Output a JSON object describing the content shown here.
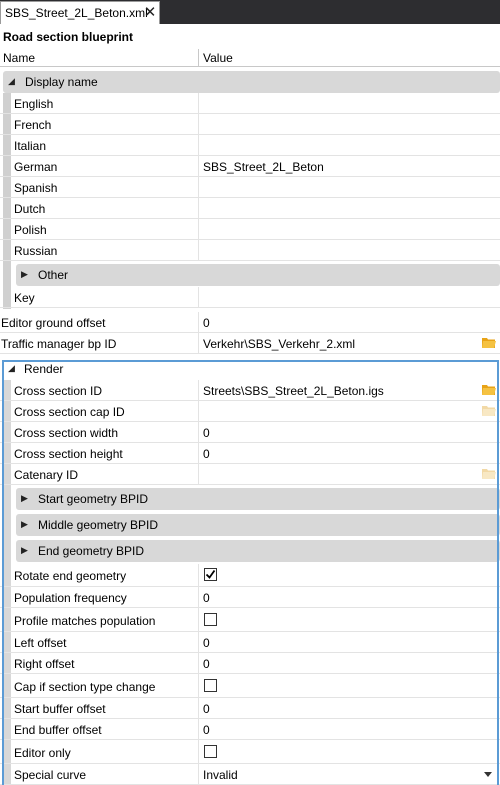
{
  "tab": {
    "title": "SBS_Street_2L_Beton.xml",
    "close": "✕"
  },
  "title": "Road section blueprint",
  "columns": {
    "name": "Name",
    "value": "Value"
  },
  "display_group": {
    "label": "Display name",
    "rows": [
      {
        "name": "English",
        "value": ""
      },
      {
        "name": "French",
        "value": ""
      },
      {
        "name": "Italian",
        "value": ""
      },
      {
        "name": "German",
        "value": "SBS_Street_2L_Beton"
      },
      {
        "name": "Spanish",
        "value": ""
      },
      {
        "name": "Dutch",
        "value": ""
      },
      {
        "name": "Polish",
        "value": ""
      },
      {
        "name": "Russian",
        "value": ""
      }
    ],
    "other_label": "Other",
    "key_label": "Key"
  },
  "editor_ground_offset": {
    "name": "Editor ground offset",
    "value": "0"
  },
  "traffic_manager": {
    "name": "Traffic manager bp ID",
    "value": "Verkehr\\SBS_Verkehr_2.xml",
    "icon": "folder-icon"
  },
  "render": {
    "label": "Render",
    "cross_section_id": {
      "name": "Cross section ID",
      "value": "Streets\\SBS_Street_2L_Beton.igs"
    },
    "cross_section_cap_id": {
      "name": "Cross section cap ID",
      "value": ""
    },
    "cross_section_width": {
      "name": "Cross section width",
      "value": "0"
    },
    "cross_section_height": {
      "name": "Cross section height",
      "value": "0"
    },
    "catenary_id": {
      "name": "Catenary ID",
      "value": ""
    },
    "start_geometry": "Start geometry BPID",
    "middle_geometry": "Middle geometry BPID",
    "end_geometry": "End geometry BPID",
    "rotate_end_geometry": {
      "name": "Rotate end geometry",
      "checked": true
    },
    "population_frequency": {
      "name": "Population frequency",
      "value": "0"
    },
    "profile_matches_population": {
      "name": "Profile matches population",
      "checked": false
    },
    "left_offset": {
      "name": "Left offset",
      "value": "0"
    },
    "right_offset": {
      "name": "Right offset",
      "value": "0"
    },
    "cap_if_section_type_change": {
      "name": "Cap if section type change",
      "checked": false
    },
    "start_buffer_offset": {
      "name": "Start buffer offset",
      "value": "0"
    },
    "end_buffer_offset": {
      "name": "End buffer offset",
      "value": "0"
    },
    "editor_only": {
      "name": "Editor only",
      "checked": false
    },
    "special_curve": {
      "name": "Special curve",
      "value": "Invalid"
    }
  },
  "colors": {
    "accent": "#5b9bd5",
    "group_bg": "#d8d8d8",
    "folder": "#e8a317",
    "folder_disabled": "#f2d9a6"
  }
}
